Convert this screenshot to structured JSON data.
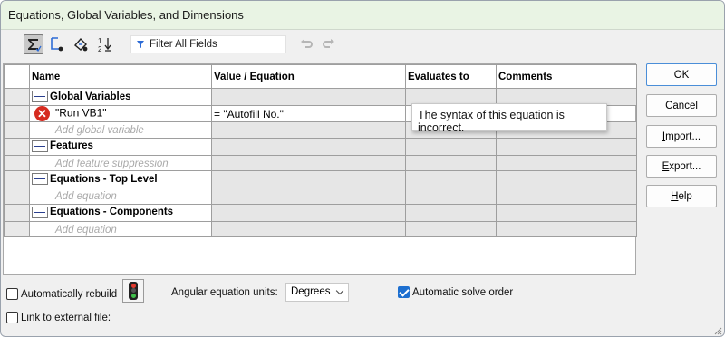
{
  "window": {
    "title": "Equations, Global Variables, and Dimensions"
  },
  "toolbar": {
    "filter_label": "Filter All Fields",
    "buttons": [
      {
        "name": "equation-view-icon",
        "active": true
      },
      {
        "name": "sketch-equation-view-icon",
        "active": false
      },
      {
        "name": "dimension-view-icon",
        "active": false
      },
      {
        "name": "ordered-view-icon",
        "active": false
      }
    ]
  },
  "table": {
    "headers": [
      "Name",
      "Value / Equation",
      "Evaluates to",
      "Comments"
    ],
    "groups": [
      {
        "label": "Global Variables",
        "rows": [
          {
            "name": "\"Run VB1\"",
            "value": "= \"Autofill No.\"",
            "error": true
          }
        ],
        "placeholder": "Add global variable"
      },
      {
        "label": "Features",
        "rows": [],
        "placeholder": "Add feature suppression"
      },
      {
        "label": "Equations - Top Level",
        "rows": [],
        "placeholder": "Add equation"
      },
      {
        "label": "Equations - Components",
        "rows": [],
        "placeholder": "Add equation"
      }
    ]
  },
  "tooltip": {
    "text": "The syntax of this equation is incorrect."
  },
  "buttons": {
    "ok": "OK",
    "cancel": "Cancel",
    "import": "Import...",
    "export": "Export...",
    "help": "Help"
  },
  "bottom": {
    "auto_rebuild_label": "Automatically rebuild",
    "auto_rebuild_checked": false,
    "angular_units_label": "Angular equation units:",
    "angular_units_value": "Degrees",
    "auto_solve_label": "Automatic solve order",
    "auto_solve_checked": true,
    "link_external_label": "Link to external file:",
    "link_external_checked": false
  },
  "colors": {
    "title_bg": "#e9f4e4",
    "error_red": "#d62b1f",
    "accent_blue": "#1d6fd0"
  }
}
